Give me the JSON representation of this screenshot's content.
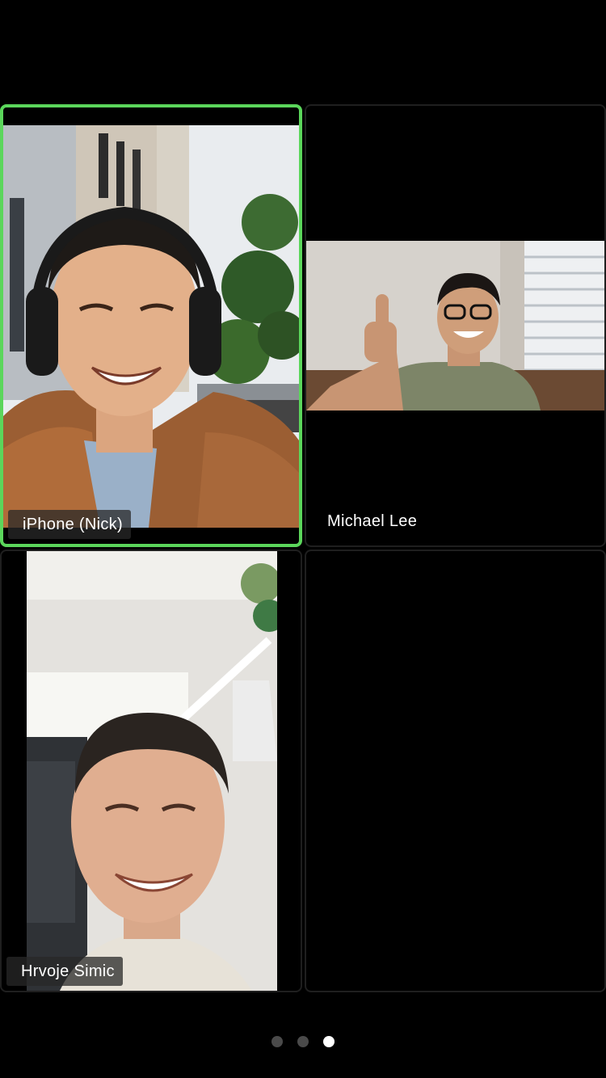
{
  "participants": [
    {
      "name": "iPhone (Nick)",
      "active_speaker": true
    },
    {
      "name": "Michael Lee",
      "active_speaker": false
    },
    {
      "name": "Hrvoje Simic",
      "active_speaker": false
    }
  ],
  "pagination": {
    "total_pages": 3,
    "current_page": 3
  },
  "colors": {
    "active_speaker_border": "#5bd65b",
    "background": "#000000"
  }
}
